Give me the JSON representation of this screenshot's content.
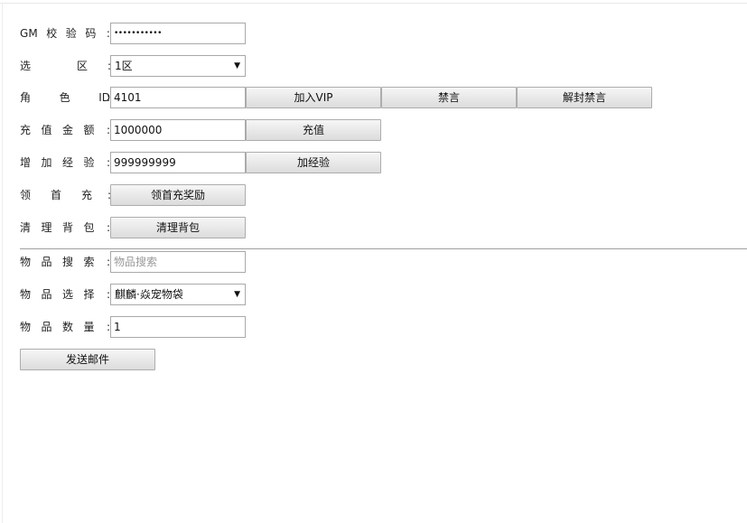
{
  "form": {
    "gm_code": {
      "label": [
        "G",
        "M",
        "校",
        "验",
        "码"
      ],
      "value": "•••••••••••"
    },
    "server": {
      "label": [
        "选",
        "区"
      ],
      "value": "1区",
      "arrow": "▼"
    },
    "role": {
      "label": [
        "角",
        "色",
        "ID"
      ],
      "value": "4101",
      "buttons": {
        "add_vip": "加入VIP",
        "mute": "禁言",
        "unmute": "解封禁言"
      }
    },
    "recharge": {
      "label": [
        "充",
        "值",
        "金",
        "额"
      ],
      "value": "1000000",
      "button": "充值"
    },
    "exp": {
      "label": [
        "增",
        "加",
        "经",
        "验"
      ],
      "value": "999999999",
      "button": "加经验"
    },
    "first_recharge": {
      "label": [
        "领",
        "首",
        "充"
      ],
      "button": "领首充奖励"
    },
    "clear_bag": {
      "label": [
        "清",
        "理",
        "背",
        "包"
      ],
      "button": "清理背包"
    },
    "item_search": {
      "label": [
        "物",
        "品",
        "搜",
        "索"
      ],
      "placeholder": "物品搜索"
    },
    "item_select": {
      "label": [
        "物",
        "品",
        "选",
        "择"
      ],
      "value": "麒麟·焱宠物袋",
      "arrow": "▼"
    },
    "item_qty": {
      "label": [
        "物",
        "品",
        "数",
        "量"
      ],
      "value": "1"
    },
    "send_mail": "发送邮件",
    "colon": ":"
  }
}
